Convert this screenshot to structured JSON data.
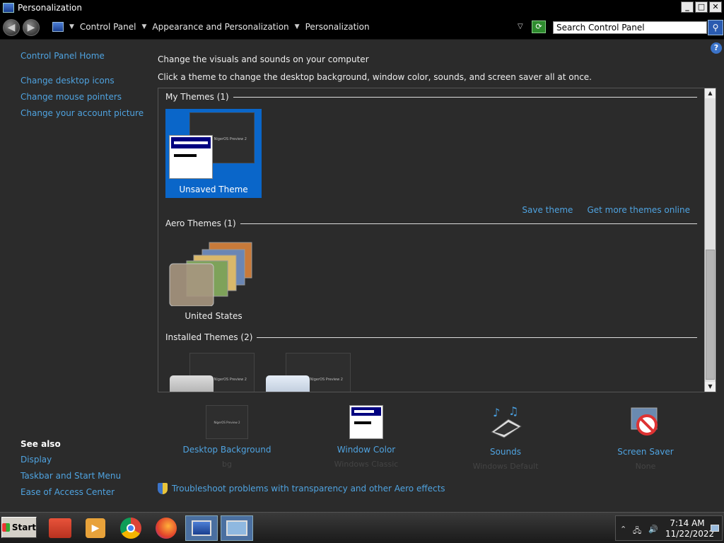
{
  "window": {
    "title": "Personalization"
  },
  "window_buttons": {
    "minimize": "_",
    "maximize": "□",
    "close": "✕"
  },
  "breadcrumbs": [
    "Control Panel",
    "Appearance and Personalization",
    "Personalization"
  ],
  "search": {
    "value": "Search Control Panel"
  },
  "left_pane": {
    "home": "Control Panel Home",
    "links": [
      "Change desktop icons",
      "Change mouse pointers",
      "Change your account picture"
    ],
    "see_also_title": "See also",
    "see_also": [
      "Display",
      "Taskbar and Start Menu",
      "Ease of Access Center"
    ]
  },
  "main": {
    "heading": "Change the visuals and sounds on your computer",
    "subheading": "Click a theme to change the desktop background, window color, sounds, and screen saver all at once.",
    "groups": {
      "my_themes": "My Themes (1)",
      "aero_themes": "Aero Themes (1)",
      "installed_themes": "Installed Themes (2)"
    },
    "themes": {
      "unsaved": "Unsaved Theme",
      "united_states": "United States",
      "preview_caption": "NigerOS Preview 2"
    },
    "actions": {
      "save": "Save theme",
      "more": "Get more themes online"
    },
    "settings": [
      {
        "name": "Desktop Background",
        "value": "bg"
      },
      {
        "name": "Window Color",
        "value": "Windows Classic"
      },
      {
        "name": "Sounds",
        "value": "Windows Default"
      },
      {
        "name": "Screen Saver",
        "value": "None"
      }
    ],
    "troubleshoot": "Troubleshoot problems with transparency and other Aero effects"
  },
  "taskbar": {
    "start": "Start",
    "clock_time": "7:14 AM",
    "clock_date": "11/22/2022"
  },
  "colors": {
    "link": "#4fa3e0",
    "selection": "#0a66c9",
    "window_bg": "#2b2b2b"
  }
}
